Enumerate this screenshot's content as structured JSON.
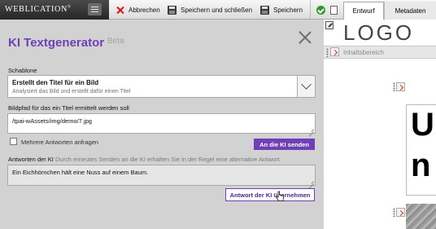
{
  "toolbar": {
    "brand": "WEBLICATION",
    "brand_reg": "®",
    "cancel_label": "Abbrechen",
    "save_close_label": "Speichern und schließen",
    "save_label": "Speichern",
    "tabs": [
      "Entwurf",
      "Metadaten"
    ],
    "active_tab": "Entwurf"
  },
  "dialog": {
    "title": "KI Textgenerator",
    "badge": "Beta",
    "template_label": "Schablone",
    "template_selected": "Erstellt den Titel für ein Bild",
    "template_description": "Analysiert das Bild und erstellt dafür einen Titel",
    "image_path_label": "Bildpfad für das ein Titel ermittelt werden soll",
    "image_path_value": "/tpai-wAssets/img/demo/7.jpg",
    "multiple_answers_label": "Mehrere Antworten anfragen",
    "multiple_answers_checked": false,
    "send_button": "An die KI senden",
    "answer_label": "Antworten der KI",
    "answer_hint": "Durch erneutes Senden an die KI erhalten Sie in der Regel eine alternative Antwort",
    "answer_value": "Ein Eichhörnchen hält eine Nuss auf einem Baum.",
    "apply_button": "Antwort der KI übernehmen"
  },
  "preview": {
    "logo_text": "LOGO",
    "content_area_label": "Inhaltsbereich",
    "big_letters": [
      "U",
      "n"
    ]
  },
  "colors": {
    "accent": "#6f3fb6",
    "toolbar_dark": "#2b2b2b",
    "cancel_red": "#dd1111",
    "confirm_green": "#2e9a2e"
  }
}
